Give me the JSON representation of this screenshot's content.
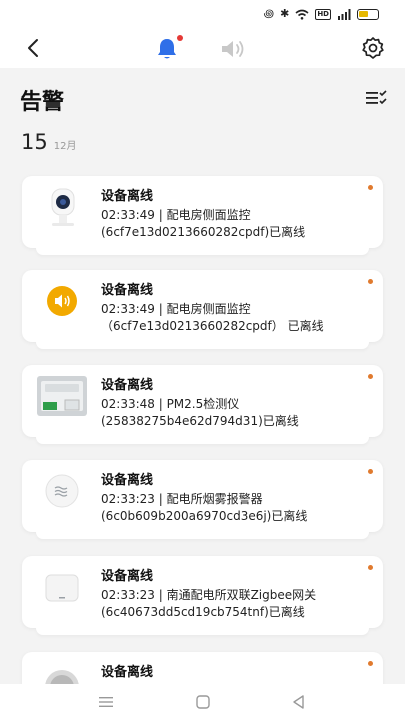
{
  "header": {
    "title": "告警",
    "tabs": [
      {
        "name": "bell-icon",
        "active": true,
        "has_badge": true
      },
      {
        "name": "speaker-icon",
        "active": false
      }
    ]
  },
  "date": {
    "day": "15",
    "month": "12月"
  },
  "alerts": [
    {
      "title": "设备离线",
      "line1": "02:33:49 | 配电房侧面监控",
      "line2": "(6cf7e13d0213660282cpdf)已离线",
      "thumb": "camera-icon"
    },
    {
      "title": "设备离线",
      "line1": "02:33:49 | 配电房侧面监控",
      "line2": "（6cf7e13d0213660282cpdf） 已离线",
      "thumb": "speaker-alarm-icon"
    },
    {
      "title": "设备离线",
      "line1": "02:33:48 | PM2.5检测仪",
      "line2": "(25838275b4e62d794d31)已离线",
      "thumb": "pm25-sensor-icon"
    },
    {
      "title": "设备离线",
      "line1": "02:33:23 | 配电所烟雾报警器",
      "line2": "(6c0b609b200a6970cd3e6j)已离线",
      "thumb": "smoke-detector-icon"
    },
    {
      "title": "设备离线",
      "line1": "02:33:23 | 南通配电所双联Zigbee网关",
      "line2": "(6c40673dd5cd19cb754tnf)已离线",
      "thumb": "gateway-icon"
    },
    {
      "title": "设备离线",
      "line1": "",
      "line2": "",
      "thumb": "round-device-icon"
    }
  ],
  "colors": {
    "accent_blue": "#2f6fe8",
    "badge_red": "#e53935",
    "unread_orange": "#e07a2e",
    "speaker_yellow": "#f2a900"
  }
}
